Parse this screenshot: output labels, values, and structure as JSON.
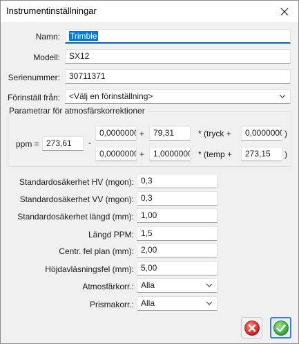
{
  "window": {
    "title": "Instrumentinställningar"
  },
  "form": {
    "name_label": "Namn:",
    "name_value": "Trimble",
    "model_label": "Modell:",
    "model_value": "SX12",
    "serial_label": "Serienummer:",
    "serial_value": "30711371",
    "preset_label": "Förinställ från:",
    "preset_value": "<Välj en förinställning>"
  },
  "atmos": {
    "title": "Parametrar för atmosfärskorrektioner",
    "ppm_label": "ppm =",
    "ppm_value": "273,61",
    "minus": "-",
    "a1": "0,0000000",
    "plus1": "+",
    "b1": "79,31",
    "tryck": "* (tryck +",
    "c1": "0,0000000",
    "close1": ")",
    "a2": "0,0000000",
    "plus2": "+",
    "b2": "1,0000000",
    "temp": "* (temp +",
    "c2": "273,15",
    "close2": ")"
  },
  "accuracy": {
    "hv_label": "Standardosäkerhet HV (mgon):",
    "hv_value": "0,3",
    "vv_label": "Standardosäkerhet VV (mgon):",
    "vv_value": "0,3",
    "len_label": "Standardosäkerhet längd (mm):",
    "len_value": "1,00",
    "ppm_label": "Längd PPM:",
    "ppm_value": "1,5",
    "centr_label": "Centr. fel plan (mm):",
    "centr_value": "2,00",
    "height_label": "Höjdavläsningsfel (mm):",
    "height_value": "5,00",
    "atmos_label": "Atmosfärkorr.:",
    "atmos_value": "Alla",
    "prism_label": "Prismakorr.:",
    "prism_value": "Alla"
  },
  "icons": {
    "close": "close-icon",
    "cancel": "cancel-icon",
    "ok": "ok-check-icon",
    "chevron": "chevron-down-icon"
  },
  "colors": {
    "selection": "#0078d7",
    "cancel": "#d62020",
    "ok": "#3aa335"
  }
}
